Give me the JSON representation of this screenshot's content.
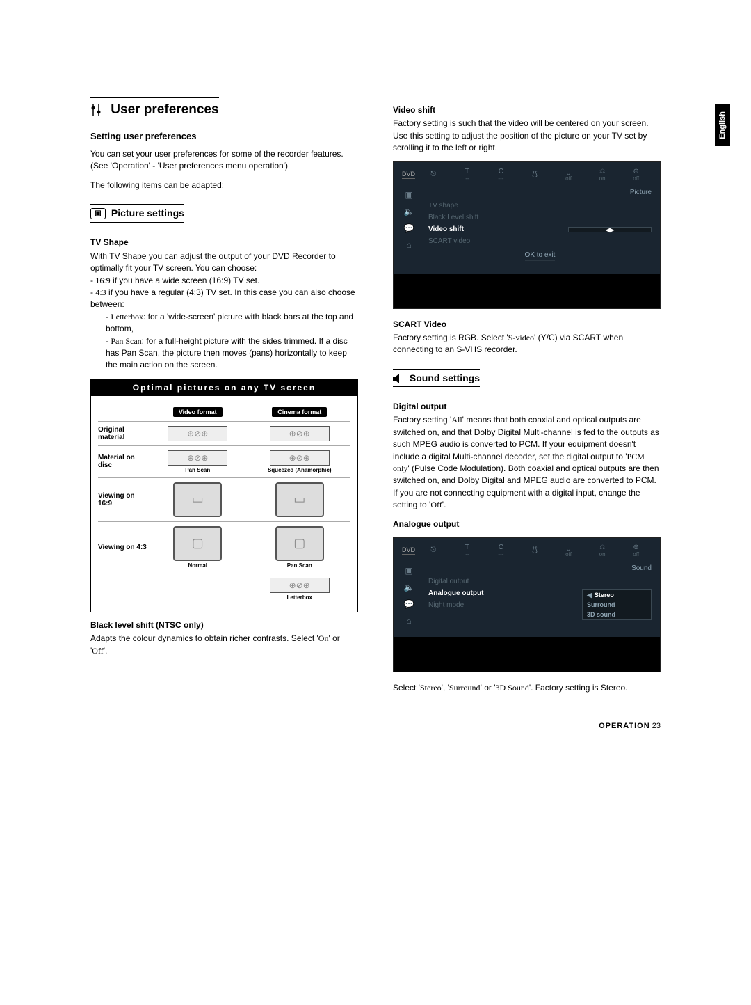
{
  "lang_tab": "English",
  "header": {
    "title": "User preferences",
    "subtitle": "Setting user preferences",
    "intro1": "You can set your user preferences for some of the recorder features. (See 'Operation' - 'User preferences menu operation')",
    "intro2": "The following items can be adapted:"
  },
  "picture": {
    "heading": "Picture settings",
    "tvshape_h": "TV Shape",
    "tvshape_p": "With TV Shape you can adjust the output of your DVD Recorder to optimally fit your TV screen. You can choose:",
    "tvshape_li1_pre": "- ",
    "tvshape_li1_b": "16:9",
    "tvshape_li1_post": " if you have a wide screen (16:9) TV set.",
    "tvshape_li2_pre": "- ",
    "tvshape_li2_b": "4:3",
    "tvshape_li2_post": " if you have a regular (4:3) TV set. In this case you can also choose between:",
    "tvshape_sub1_pre": "- ",
    "tvshape_sub1_b": "Letterbox",
    "tvshape_sub1_post": ": for a 'wide-screen' picture with black bars at the top and bottom,",
    "tvshape_sub2_pre": "- ",
    "tvshape_sub2_b": "Pan Scan",
    "tvshape_sub2_post": ": for a full-height picture with the sides trimmed. If a disc has Pan Scan, the picture then moves (pans) horizontally to keep the main action on the screen.",
    "diagram_title": "Optimal pictures on any TV screen",
    "diagram": {
      "col1": "Video format",
      "col2": "Cinema format",
      "rows": [
        {
          "label": "Original material",
          "cap1": "",
          "cap2": ""
        },
        {
          "label": "Material on disc",
          "cap1": "Pan Scan",
          "cap2": "Squeezed (Anamorphic)"
        },
        {
          "label": "Viewing on 16:9",
          "cap1": "",
          "cap2": ""
        },
        {
          "label": "Viewing on 4:3",
          "cap1": "Normal",
          "cap2": "Pan Scan"
        },
        {
          "label": "",
          "cap1": "",
          "cap2": "Letterbox"
        }
      ]
    },
    "black_h": "Black level shift (NTSC only)",
    "black_p_pre": "Adapts the colour dynamics to obtain richer contrasts. Select '",
    "black_on": "On",
    "black_mid": "' or '",
    "black_off": "Off",
    "black_post": "'."
  },
  "video_shift": {
    "h": "Video shift",
    "p": "Factory setting is such that the video will be centered on your screen. Use this setting to adjust the position of the picture on your TV set by scrolling it to the left or right."
  },
  "osd1": {
    "tag": "Picture",
    "top_vals": [
      "--",
      "---",
      "",
      "off",
      "on",
      "off"
    ],
    "items": [
      "TV shape",
      "Black Level shift",
      "Video shift",
      "SCART video"
    ],
    "selected": "Video shift",
    "ok": "OK to exit"
  },
  "scart": {
    "h_pre": "SCART",
    "h_post": " Video",
    "p_pre": "Factory setting is RGB. Select '",
    "p_b": "S-video",
    "p_mid": "' (Y/C) via ",
    "p_sc": "SCART",
    "p_post": " when connecting to an S-VHS recorder."
  },
  "sound": {
    "heading": "Sound settings",
    "digital_h": "Digital output",
    "digital_p_pre": "Factory setting '",
    "digital_all": "All",
    "digital_p_mid1": "' means that both coaxial and optical outputs are switched on, and that Dolby Digital Multi-channel is fed to the outputs as such MPEG audio is converted to PCM. If your equipment doesn't include a digital Multi-channel decoder, set the digital output to '",
    "digital_pcm": "PCM only",
    "digital_p_mid2": "' (Pulse Code Modulation). Both coaxial and optical outputs are then switched on, and Dolby Digital and MPEG audio are converted to PCM. If you are not connecting equipment with a digital input, change the setting to '",
    "digital_off": "Off",
    "digital_p_post": "'.",
    "analogue_h": "Analogue output",
    "analogue_p_pre": "Select '",
    "analogue_stereo": "Stereo",
    "analogue_mid1": "', '",
    "analogue_surround": "Surround",
    "analogue_mid2": "' or '",
    "analogue_3d": "3D Sound",
    "analogue_post": "'. Factory setting is Stereo."
  },
  "osd2": {
    "tag": "Sound",
    "top_vals": [
      "--",
      "---",
      "",
      "off",
      "on",
      "off"
    ],
    "items": [
      "Digital output",
      "Analogue output",
      "Night mode"
    ],
    "selected": "Analogue output",
    "options": [
      "Stereo",
      "Surround",
      "3D sound"
    ],
    "opt_selected": "Stereo"
  },
  "footer": {
    "label": "OPERATION",
    "page": "23"
  }
}
